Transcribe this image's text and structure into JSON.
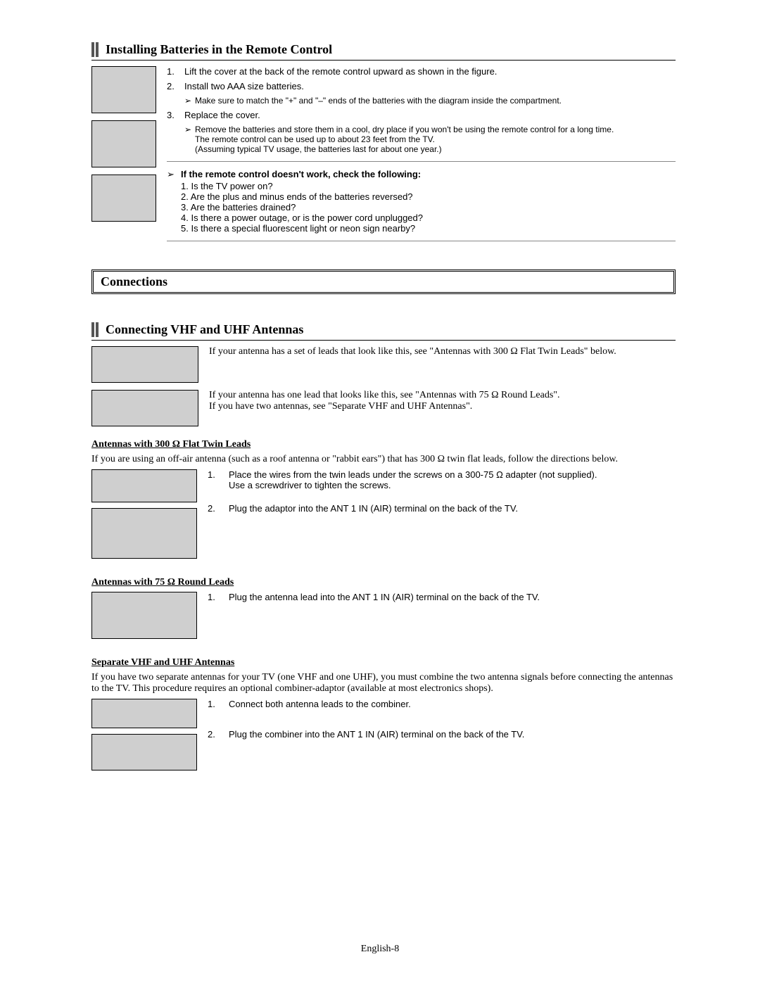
{
  "section1": {
    "title": "Installing Batteries in the Remote Control",
    "step1": "Lift the cover at the back of the remote control upward as shown in the figure.",
    "step2": "Install two AAA size batteries.",
    "note2": "Make sure to match the \"+\" and \"–\" ends of the batteries with the diagram inside the compartment.",
    "step3": "Replace the cover.",
    "note3a": "Remove the batteries and store them in a cool, dry place if you won't be using the remote control for a long time.",
    "note3b": "The remote control can be used up to about 23 feet from the TV.",
    "note3c": "(Assuming typical TV usage, the batteries last for about one year.)",
    "trouble_title": "If the remote control doesn't work, check the following:",
    "q1": "1. Is the TV power on?",
    "q2": "2. Are the plus and minus ends of the batteries reversed?",
    "q3": "3. Are the batteries drained?",
    "q4": "4. Is there a power outage, or is the power cord unplugged?",
    "q5": "5. Is there a special fluorescent light or neon sign nearby?"
  },
  "connections_title": "Connections",
  "section2": {
    "title": "Connecting VHF and UHF Antennas",
    "lead1": "If your antenna has a set of leads that look like this, see \"Antennas with 300 Ω Flat Twin Leads\" below.",
    "lead2a": "If your antenna has one lead that looks like this, see \"Antennas with 75 Ω Round Leads\".",
    "lead2b": "If you have two antennas, see \"Separate VHF and UHF Antennas\".",
    "sub1": "Antennas with 300 Ω Flat Twin Leads",
    "sub1_intro": "If you are using an off-air antenna (such as a roof antenna or \"rabbit ears\") that has 300 Ω twin flat leads, follow the directions below.",
    "sub1_step1a": "Place the wires from the twin leads under the screws on a 300-75 Ω adapter (not supplied).",
    "sub1_step1b": "Use a screwdriver to tighten the screws.",
    "sub1_step2": "Plug the adaptor into the ANT 1 IN (AIR) terminal on the back of the TV.",
    "sub2": "Antennas with 75 Ω Round Leads",
    "sub2_step1": "Plug the antenna lead into the ANT 1 IN (AIR) terminal on the back of the TV.",
    "sub3": "Separate VHF and UHF Antennas",
    "sub3_intro": "If you have two separate antennas for your TV (one VHF and one UHF), you must combine the two antenna signals before connecting the antennas to the TV. This procedure requires an optional combiner-adaptor (available at most electronics shops).",
    "sub3_step1": "Connect both antenna leads to the combiner.",
    "sub3_step2": "Plug the combiner into the ANT 1 IN (AIR) terminal on the back of the TV."
  },
  "page_number": "English-8",
  "num1": "1.",
  "num2": "2.",
  "num3": "3.",
  "arrow": "➢"
}
